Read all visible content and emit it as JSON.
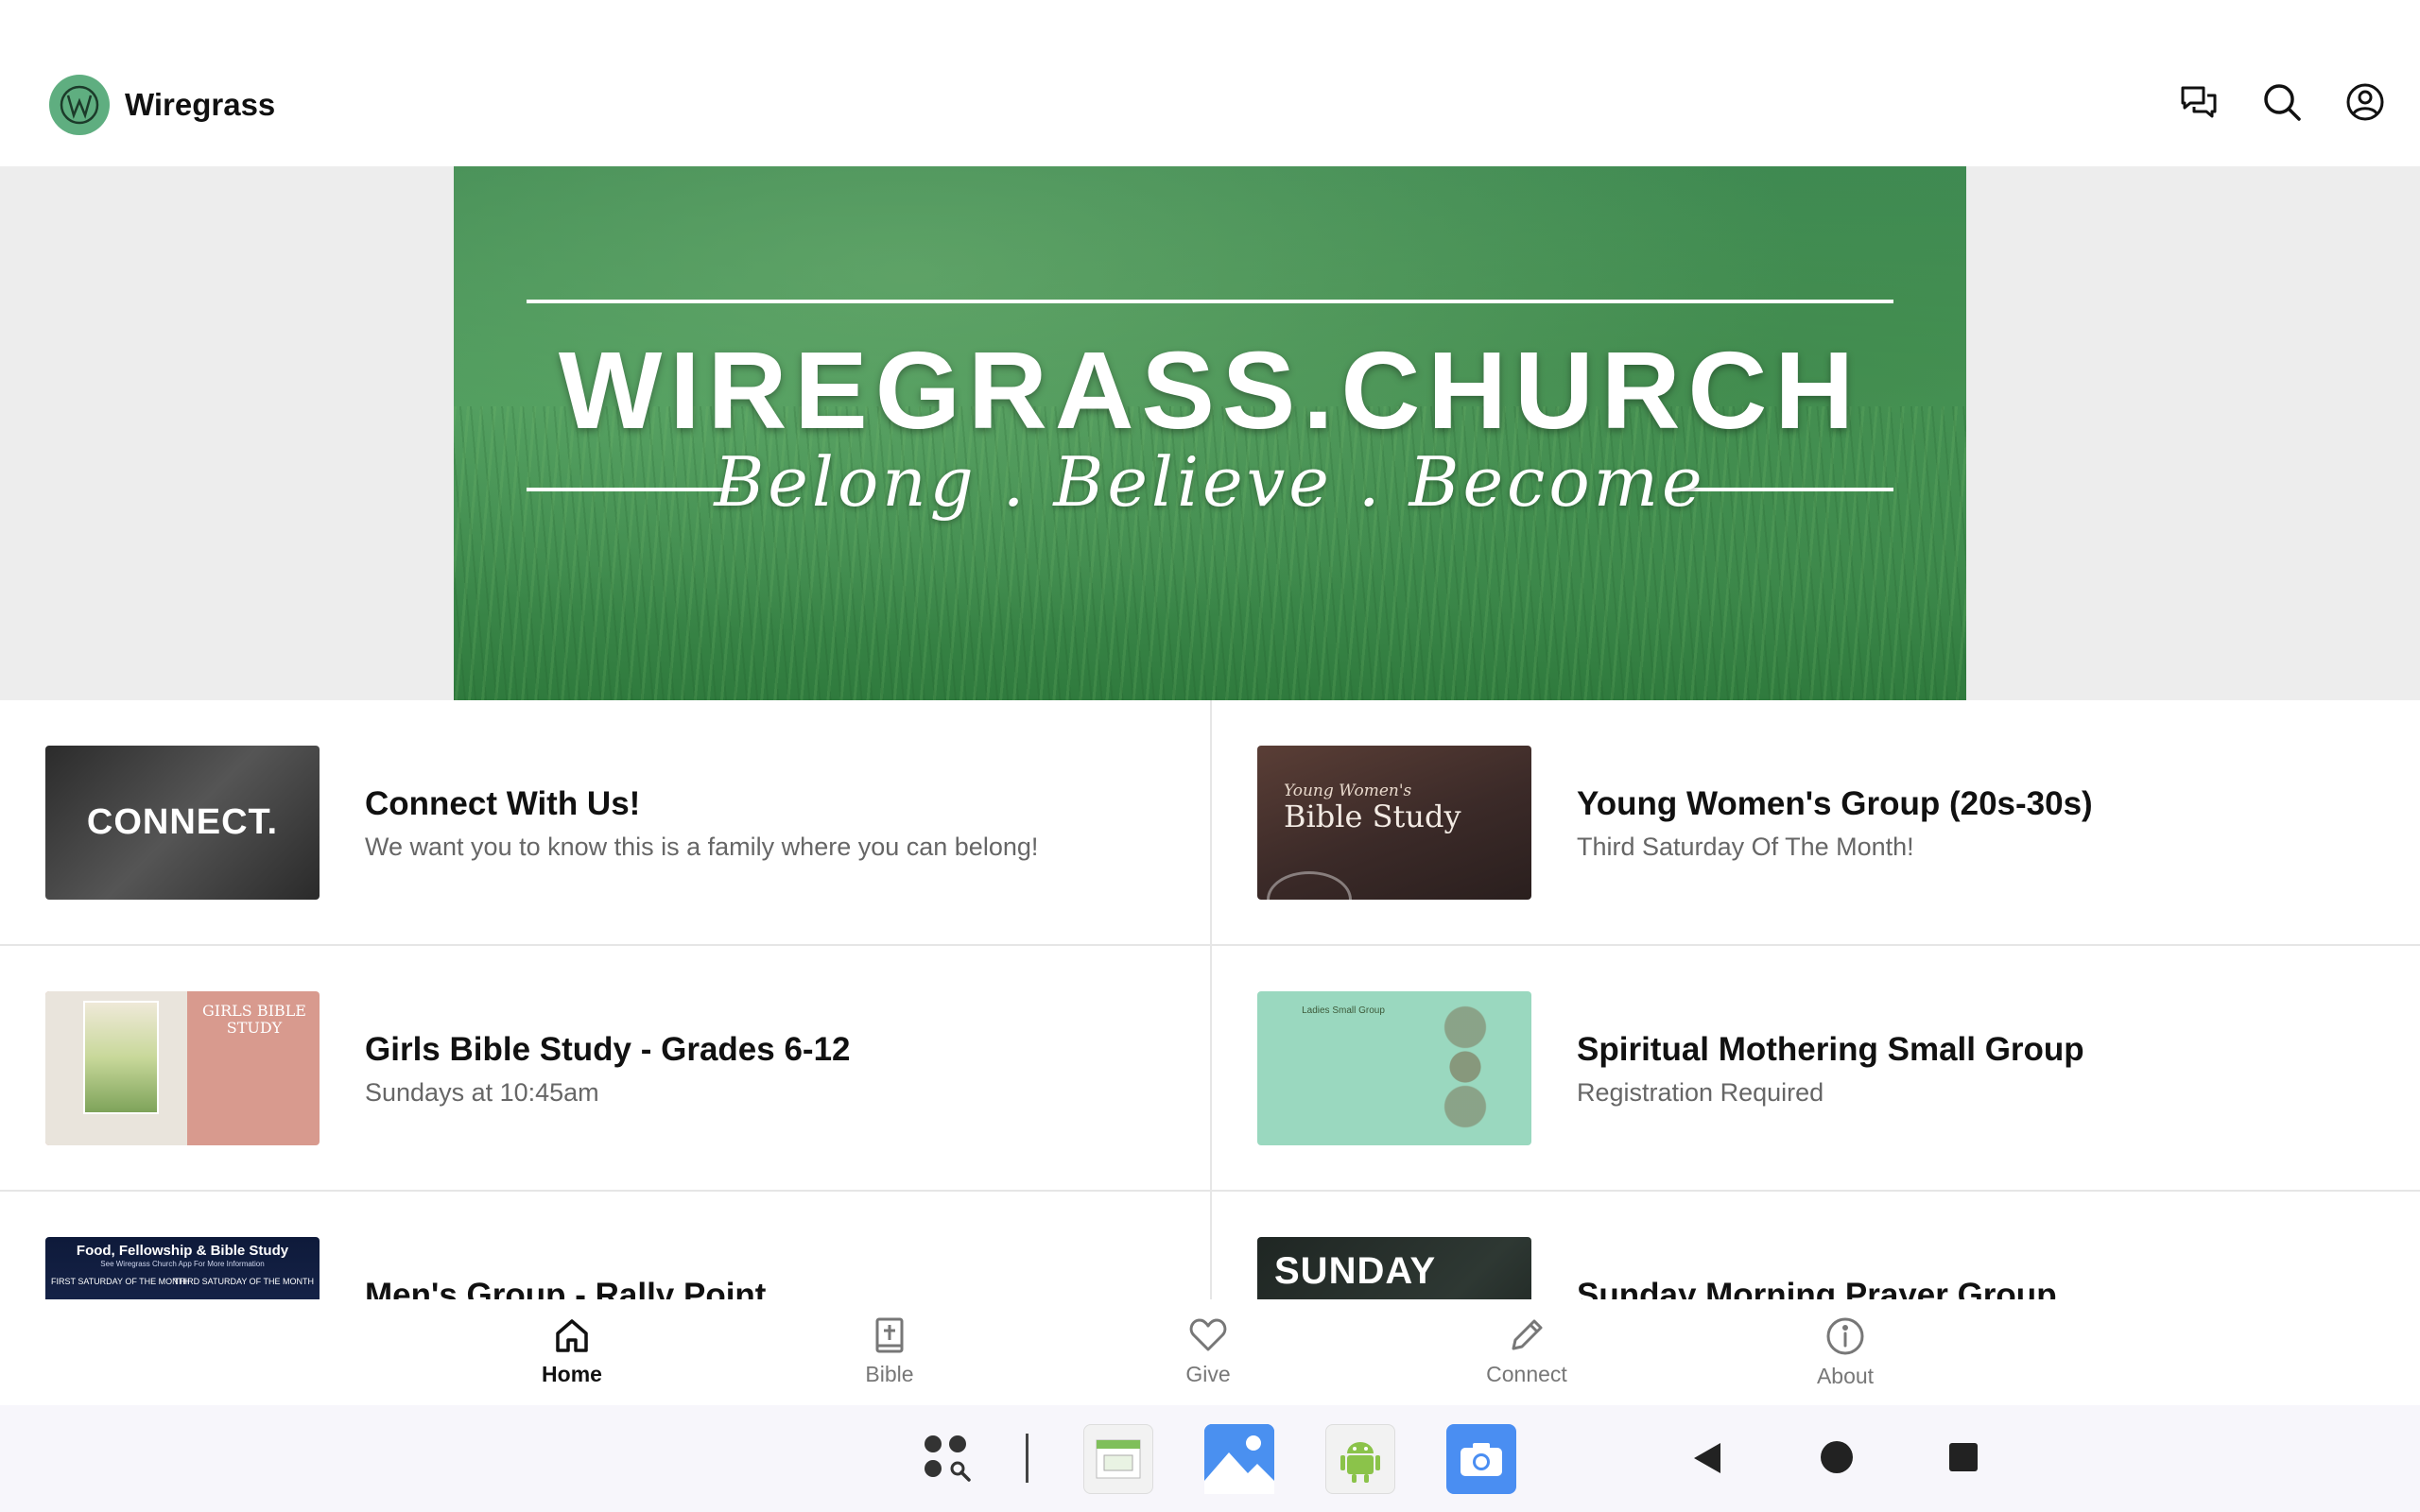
{
  "app": {
    "name": "Wiregrass",
    "brand_color": "#5fae80"
  },
  "header": {
    "actions": [
      {
        "icon": "chat-icon"
      },
      {
        "icon": "search-icon"
      },
      {
        "icon": "account-icon"
      }
    ]
  },
  "banner": {
    "title": "WIREGRASS.CHURCH",
    "tagline": "Belong . Believe . Become"
  },
  "feed": {
    "items": [
      {
        "title": "Connect With Us!",
        "subtitle": "We want you to know this is a family where you can belong!",
        "thumb_text": "CONNECT."
      },
      {
        "title": "Young Women's Group (20s-30s)",
        "subtitle": "Third Saturday Of The Month!",
        "thumb_text_1": "Young Women's",
        "thumb_text_2": "Bible Study"
      },
      {
        "title": "Girls Bible Study - Grades 6-12",
        "subtitle": "Sundays at 10:45am",
        "thumb_text": "GIRLS BIBLE STUDY"
      },
      {
        "title": "Spiritual Mothering Small Group",
        "subtitle": "Registration Required",
        "thumb_text": "Ladies Small Group"
      },
      {
        "title": "Men's Group - Rally Point",
        "subtitle": "",
        "thumb_text": "Food, Fellowship & Bible Study",
        "thumb_sub": "See Wiregrass Church App For More Information",
        "thumb_left": "FIRST SATURDAY OF THE MONTH",
        "thumb_right": "THIRD SATURDAY OF THE MONTH"
      },
      {
        "title": "Sunday Morning Prayer Group",
        "subtitle": "",
        "thumb_text": "SUNDAY"
      }
    ]
  },
  "bottom_nav": {
    "active": "Home",
    "items": [
      {
        "label": "Home",
        "icon": "home-icon"
      },
      {
        "label": "Bible",
        "icon": "bible-icon"
      },
      {
        "label": "Give",
        "icon": "heart-icon"
      },
      {
        "label": "Connect",
        "icon": "pencil-icon"
      },
      {
        "label": "About",
        "icon": "info-icon"
      }
    ]
  },
  "system_bar": {
    "apps": [
      "app-drawer-icon",
      "calendar-app-icon",
      "gallery-app-icon",
      "android-app-icon",
      "camera-app-icon"
    ],
    "nav": [
      "back-icon",
      "home-circle-icon",
      "recents-icon"
    ]
  }
}
